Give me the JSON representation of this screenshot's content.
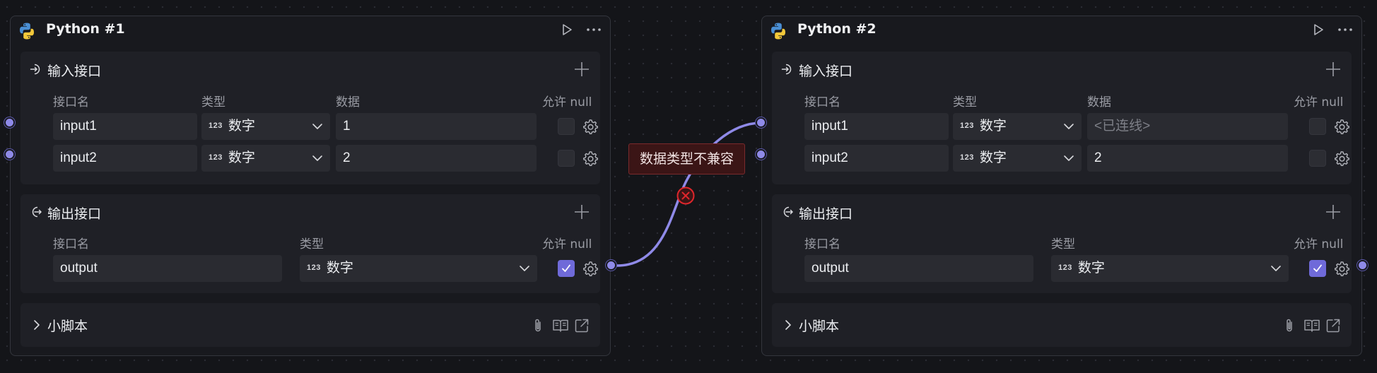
{
  "nodes": [
    {
      "title": "Python #1",
      "input_section": {
        "title": "输入接口",
        "col_name": "接口名",
        "col_type": "类型",
        "col_data": "数据",
        "col_null": "允许 null",
        "rows": [
          {
            "name": "input1",
            "type_badge": "123",
            "type": "数字",
            "data": "1",
            "allow_null": false
          },
          {
            "name": "input2",
            "type_badge": "123",
            "type": "数字",
            "data": "2",
            "allow_null": false
          }
        ]
      },
      "output_section": {
        "title": "输出接口",
        "col_name": "接口名",
        "col_type": "类型",
        "col_null": "允许 null",
        "rows": [
          {
            "name": "output",
            "type_badge": "123",
            "type": "数字",
            "allow_null": true
          }
        ]
      },
      "script_section": {
        "title": "小脚本"
      }
    },
    {
      "title": "Python #2",
      "input_section": {
        "title": "输入接口",
        "col_name": "接口名",
        "col_type": "类型",
        "col_data": "数据",
        "col_null": "允许 null",
        "rows": [
          {
            "name": "input1",
            "type_badge": "123",
            "type": "数字",
            "data": "<已连线>",
            "allow_null": false
          },
          {
            "name": "input2",
            "type_badge": "123",
            "type": "数字",
            "data": "2",
            "allow_null": false
          }
        ]
      },
      "output_section": {
        "title": "输出接口",
        "col_name": "接口名",
        "col_type": "类型",
        "col_null": "允许 null",
        "rows": [
          {
            "name": "output",
            "type_badge": "123",
            "type": "数字",
            "allow_null": true
          }
        ]
      },
      "script_section": {
        "title": "小脚本"
      }
    }
  ],
  "connection": {
    "error_label": "数据类型不兼容",
    "wire_color": "#8f8ae8",
    "error_color": "#e0262c"
  },
  "colors": {
    "accent": "#6f6ad9",
    "port": "#8f8ae8",
    "node_bg": "#18191e",
    "section_bg": "#1f2026",
    "field_bg": "#2a2b31"
  },
  "icons": {
    "header": [
      "python-logo-icon",
      "play-icon",
      "more-horizontal-icon"
    ],
    "sections": [
      "input-port-icon",
      "output-port-icon",
      "chevron-right-icon",
      "plus-icon"
    ],
    "rows": [
      "chevron-down-icon",
      "gear-icon",
      "check-icon"
    ],
    "script": [
      "paperclip-icon",
      "book-open-icon",
      "external-link-icon"
    ],
    "wire": [
      "error-x-circle-icon"
    ]
  }
}
